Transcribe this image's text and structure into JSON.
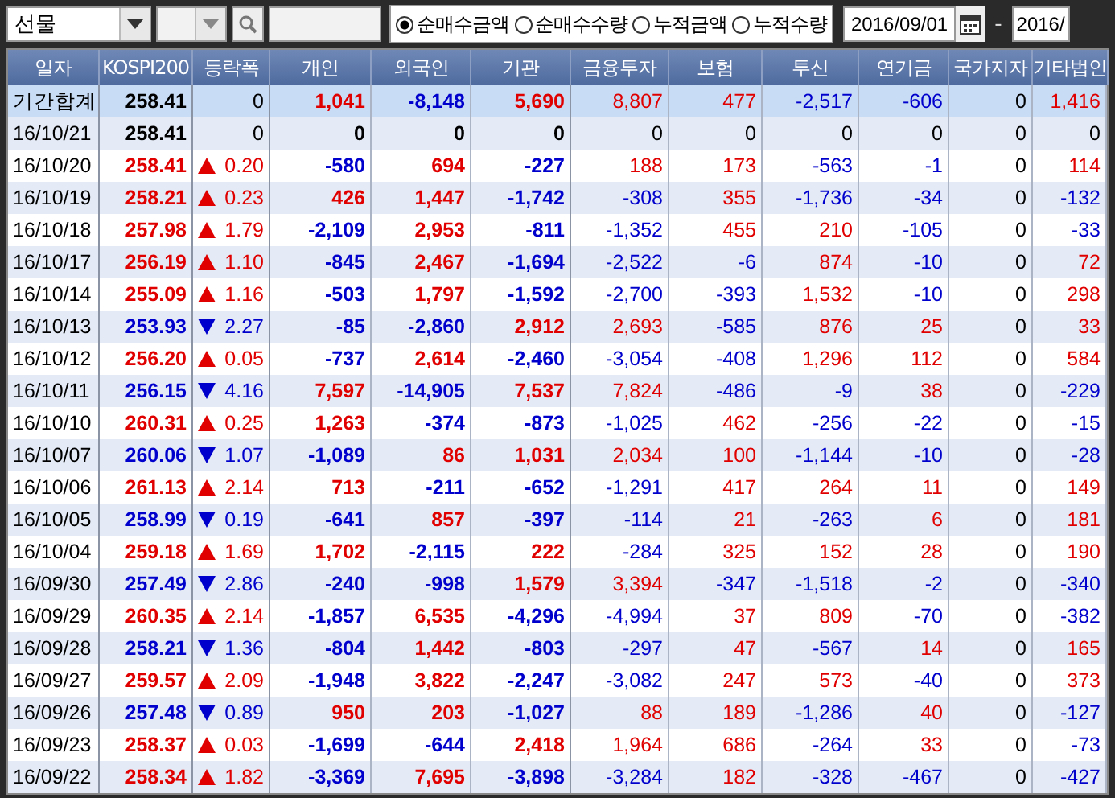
{
  "toolbar": {
    "market": "선물",
    "options": [
      {
        "label": "순매수금액",
        "selected": true
      },
      {
        "label": "순매수수량",
        "selected": false
      },
      {
        "label": "누적금액",
        "selected": false
      },
      {
        "label": "누적수량",
        "selected": false
      }
    ],
    "date_from": "2016/09/01",
    "date_sep": "-",
    "date_to": "2016/"
  },
  "table": {
    "columns": [
      "일자",
      "KOSPI200",
      "등락폭",
      "개인",
      "외국인",
      "기관",
      "금융투자",
      "보험",
      "투신",
      "연기금",
      "국가지자",
      "기타법인"
    ],
    "rows": [
      {
        "kind": "summary",
        "date": "기간합계",
        "kospi": "258.41",
        "up": false,
        "down": false,
        "change": "0",
        "values": [
          "1,041",
          "-8,148",
          "5,690",
          "8,807",
          "477",
          "-2,517",
          "-606",
          "0",
          "1,416"
        ]
      },
      {
        "kind": "day",
        "date": "16/10/21",
        "kospi": "258.41",
        "up": false,
        "down": false,
        "change": "0",
        "values": [
          "0",
          "0",
          "0",
          "0",
          "0",
          "0",
          "0",
          "0",
          "0"
        ]
      },
      {
        "kind": "day",
        "date": "16/10/20",
        "kospi": "258.41",
        "up": true,
        "down": false,
        "change": "0.20",
        "values": [
          "-580",
          "694",
          "-227",
          "188",
          "173",
          "-563",
          "-1",
          "0",
          "114"
        ]
      },
      {
        "kind": "day",
        "date": "16/10/19",
        "kospi": "258.21",
        "up": true,
        "down": false,
        "change": "0.23",
        "values": [
          "426",
          "1,447",
          "-1,742",
          "-308",
          "355",
          "-1,736",
          "-34",
          "0",
          "-132"
        ]
      },
      {
        "kind": "day",
        "date": "16/10/18",
        "kospi": "257.98",
        "up": true,
        "down": false,
        "change": "1.79",
        "values": [
          "-2,109",
          "2,953",
          "-811",
          "-1,352",
          "455",
          "210",
          "-105",
          "0",
          "-33"
        ]
      },
      {
        "kind": "day",
        "date": "16/10/17",
        "kospi": "256.19",
        "up": true,
        "down": false,
        "change": "1.10",
        "values": [
          "-845",
          "2,467",
          "-1,694",
          "-2,522",
          "-6",
          "874",
          "-10",
          "0",
          "72"
        ]
      },
      {
        "kind": "day",
        "date": "16/10/14",
        "kospi": "255.09",
        "up": true,
        "down": false,
        "change": "1.16",
        "values": [
          "-503",
          "1,797",
          "-1,592",
          "-2,700",
          "-393",
          "1,532",
          "-10",
          "0",
          "298"
        ]
      },
      {
        "kind": "day",
        "date": "16/10/13",
        "kospi": "253.93",
        "up": false,
        "down": true,
        "change": "2.27",
        "values": [
          "-85",
          "-2,860",
          "2,912",
          "2,693",
          "-585",
          "876",
          "25",
          "0",
          "33"
        ]
      },
      {
        "kind": "day",
        "date": "16/10/12",
        "kospi": "256.20",
        "up": true,
        "down": false,
        "change": "0.05",
        "values": [
          "-737",
          "2,614",
          "-2,460",
          "-3,054",
          "-408",
          "1,296",
          "112",
          "0",
          "584"
        ]
      },
      {
        "kind": "day",
        "date": "16/10/11",
        "kospi": "256.15",
        "up": false,
        "down": true,
        "change": "4.16",
        "values": [
          "7,597",
          "-14,905",
          "7,537",
          "7,824",
          "-486",
          "-9",
          "38",
          "0",
          "-229"
        ]
      },
      {
        "kind": "day",
        "date": "16/10/10",
        "kospi": "260.31",
        "up": true,
        "down": false,
        "change": "0.25",
        "values": [
          "1,263",
          "-374",
          "-873",
          "-1,025",
          "462",
          "-256",
          "-22",
          "0",
          "-15"
        ]
      },
      {
        "kind": "day",
        "date": "16/10/07",
        "kospi": "260.06",
        "up": false,
        "down": true,
        "change": "1.07",
        "values": [
          "-1,089",
          "86",
          "1,031",
          "2,034",
          "100",
          "-1,144",
          "-10",
          "0",
          "-28"
        ]
      },
      {
        "kind": "day",
        "date": "16/10/06",
        "kospi": "261.13",
        "up": true,
        "down": false,
        "change": "2.14",
        "values": [
          "713",
          "-211",
          "-652",
          "-1,291",
          "417",
          "264",
          "11",
          "0",
          "149"
        ]
      },
      {
        "kind": "day",
        "date": "16/10/05",
        "kospi": "258.99",
        "up": false,
        "down": true,
        "change": "0.19",
        "values": [
          "-641",
          "857",
          "-397",
          "-114",
          "21",
          "-263",
          "6",
          "0",
          "181"
        ]
      },
      {
        "kind": "day",
        "date": "16/10/04",
        "kospi": "259.18",
        "up": true,
        "down": false,
        "change": "1.69",
        "values": [
          "1,702",
          "-2,115",
          "222",
          "-284",
          "325",
          "152",
          "28",
          "0",
          "190"
        ]
      },
      {
        "kind": "day",
        "date": "16/09/30",
        "kospi": "257.49",
        "up": false,
        "down": true,
        "change": "2.86",
        "values": [
          "-240",
          "-998",
          "1,579",
          "3,394",
          "-347",
          "-1,518",
          "-2",
          "0",
          "-340"
        ]
      },
      {
        "kind": "day",
        "date": "16/09/29",
        "kospi": "260.35",
        "up": true,
        "down": false,
        "change": "2.14",
        "values": [
          "-1,857",
          "6,535",
          "-4,296",
          "-4,994",
          "37",
          "809",
          "-70",
          "0",
          "-382"
        ]
      },
      {
        "kind": "day",
        "date": "16/09/28",
        "kospi": "258.21",
        "up": false,
        "down": true,
        "change": "1.36",
        "values": [
          "-804",
          "1,442",
          "-803",
          "-297",
          "47",
          "-567",
          "14",
          "0",
          "165"
        ]
      },
      {
        "kind": "day",
        "date": "16/09/27",
        "kospi": "259.57",
        "up": true,
        "down": false,
        "change": "2.09",
        "values": [
          "-1,948",
          "3,822",
          "-2,247",
          "-3,082",
          "247",
          "573",
          "-40",
          "0",
          "373"
        ]
      },
      {
        "kind": "day",
        "date": "16/09/26",
        "kospi": "257.48",
        "up": false,
        "down": true,
        "change": "0.89",
        "values": [
          "950",
          "203",
          "-1,027",
          "88",
          "189",
          "-1,286",
          "40",
          "0",
          "-127"
        ]
      },
      {
        "kind": "day",
        "date": "16/09/23",
        "kospi": "258.37",
        "up": true,
        "down": false,
        "change": "0.03",
        "values": [
          "-1,699",
          "-644",
          "2,418",
          "1,964",
          "686",
          "-264",
          "33",
          "0",
          "-73"
        ]
      },
      {
        "kind": "day",
        "date": "16/09/22",
        "kospi": "258.34",
        "up": true,
        "down": false,
        "change": "1.82",
        "values": [
          "-3,369",
          "7,695",
          "-3,898",
          "-3,284",
          "182",
          "-328",
          "-467",
          "0",
          "-427"
        ]
      }
    ]
  }
}
